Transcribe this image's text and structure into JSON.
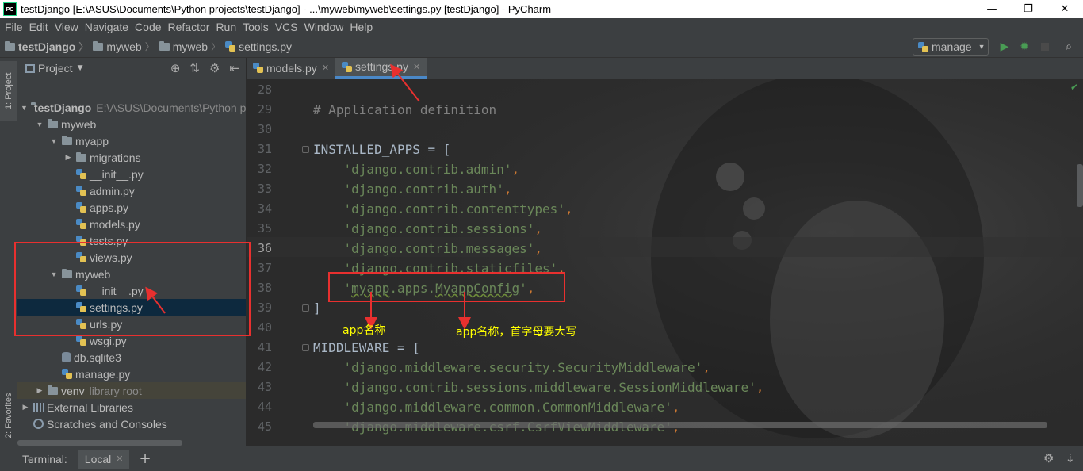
{
  "window": {
    "title": "testDjango [E:\\ASUS\\Documents\\Python projects\\testDjango] - ...\\myweb\\myweb\\settings.py [testDjango] - PyCharm",
    "logo_text": "PC",
    "minimize": "—",
    "maximize": "❐",
    "close": "✕"
  },
  "menu": [
    "File",
    "Edit",
    "View",
    "Navigate",
    "Code",
    "Refactor",
    "Run",
    "Tools",
    "VCS",
    "Window",
    "Help"
  ],
  "breadcrumb": [
    "testDjango",
    "myweb",
    "myweb",
    "settings.py"
  ],
  "run_config": {
    "label": "manage",
    "icons": [
      "run-icon",
      "debug-icon",
      "stop-icon",
      "search-icon"
    ]
  },
  "left_strip": {
    "project_tab": "1: Project",
    "favorites_tab": "2: Favorites"
  },
  "project_panel": {
    "title": "Project",
    "tree": [
      {
        "name": "testDjango",
        "extra": "E:\\ASUS\\Documents\\Python pr",
        "type": "folder",
        "depth": 0,
        "open": true,
        "bold": true
      },
      {
        "name": "myweb",
        "type": "folder",
        "depth": 1,
        "open": true
      },
      {
        "name": "myapp",
        "type": "folder",
        "depth": 2,
        "open": true
      },
      {
        "name": "migrations",
        "type": "folder",
        "depth": 3,
        "open": false
      },
      {
        "name": "__init__.py",
        "type": "py",
        "depth": 3
      },
      {
        "name": "admin.py",
        "type": "py",
        "depth": 3
      },
      {
        "name": "apps.py",
        "type": "py",
        "depth": 3
      },
      {
        "name": "models.py",
        "type": "py",
        "depth": 3
      },
      {
        "name": "tests.py",
        "type": "py",
        "depth": 3
      },
      {
        "name": "views.py",
        "type": "py",
        "depth": 3
      },
      {
        "name": "myweb",
        "type": "folder",
        "depth": 2,
        "open": true
      },
      {
        "name": "__init__.py",
        "type": "py",
        "depth": 3
      },
      {
        "name": "settings.py",
        "type": "py",
        "depth": 3,
        "selected": true
      },
      {
        "name": "urls.py",
        "type": "py",
        "depth": 3
      },
      {
        "name": "wsgi.py",
        "type": "py",
        "depth": 3
      },
      {
        "name": "db.sqlite3",
        "type": "db",
        "depth": 2
      },
      {
        "name": "manage.py",
        "type": "py",
        "depth": 2
      },
      {
        "name": "venv",
        "extra": "library root",
        "type": "folder",
        "depth": 1,
        "open": false,
        "lib": true
      },
      {
        "name": "External Libraries",
        "type": "lib",
        "depth": 0,
        "open": false
      },
      {
        "name": "Scratches and Consoles",
        "type": "scratch",
        "depth": 0
      }
    ]
  },
  "editor": {
    "tabs": [
      {
        "label": "models.py",
        "active": false
      },
      {
        "label": "settings.py",
        "active": true
      }
    ],
    "current_line": 36,
    "lines": [
      {
        "n": 28,
        "parts": []
      },
      {
        "n": 29,
        "parts": [
          {
            "t": "# Application definition",
            "c": "cm"
          }
        ]
      },
      {
        "n": 30,
        "parts": []
      },
      {
        "n": 31,
        "parts": [
          {
            "t": "INSTALLED_APPS = [",
            "c": ""
          }
        ]
      },
      {
        "n": 32,
        "parts": [
          {
            "t": "    ",
            "c": ""
          },
          {
            "t": "'django.contrib.admin'",
            "c": "st"
          },
          {
            "t": ",",
            "c": "pn"
          }
        ]
      },
      {
        "n": 33,
        "parts": [
          {
            "t": "    ",
            "c": ""
          },
          {
            "t": "'django.contrib.auth'",
            "c": "st"
          },
          {
            "t": ",",
            "c": "pn"
          }
        ]
      },
      {
        "n": 34,
        "parts": [
          {
            "t": "    ",
            "c": ""
          },
          {
            "t": "'django.contrib.contenttypes'",
            "c": "st"
          },
          {
            "t": ",",
            "c": "pn"
          }
        ]
      },
      {
        "n": 35,
        "parts": [
          {
            "t": "    ",
            "c": ""
          },
          {
            "t": "'django.contrib.sessions'",
            "c": "st"
          },
          {
            "t": ",",
            "c": "pn"
          }
        ]
      },
      {
        "n": 36,
        "parts": [
          {
            "t": "    ",
            "c": ""
          },
          {
            "t": "'django.contrib.messages'",
            "c": "st"
          },
          {
            "t": ",",
            "c": "pn"
          }
        ]
      },
      {
        "n": 37,
        "parts": [
          {
            "t": "    ",
            "c": ""
          },
          {
            "t": "'django.contrib.staticfiles'",
            "c": "st"
          },
          {
            "t": ",",
            "c": "pn"
          }
        ]
      },
      {
        "n": 38,
        "parts": [
          {
            "t": "    ",
            "c": ""
          },
          {
            "t": "'",
            "c": "st"
          },
          {
            "t": "myapp",
            "c": "st sq"
          },
          {
            "t": ".apps.",
            "c": "st"
          },
          {
            "t": "MyappConfig",
            "c": "st sq"
          },
          {
            "t": "'",
            "c": "st"
          },
          {
            "t": ",",
            "c": "pn"
          }
        ]
      },
      {
        "n": 39,
        "parts": [
          {
            "t": "]",
            "c": ""
          }
        ]
      },
      {
        "n": 40,
        "parts": []
      },
      {
        "n": 41,
        "parts": [
          {
            "t": "MIDDLEWARE = [",
            "c": ""
          }
        ]
      },
      {
        "n": 42,
        "parts": [
          {
            "t": "    ",
            "c": ""
          },
          {
            "t": "'django.middleware.security.SecurityMiddleware'",
            "c": "st"
          },
          {
            "t": ",",
            "c": "pn"
          }
        ]
      },
      {
        "n": 43,
        "parts": [
          {
            "t": "    ",
            "c": ""
          },
          {
            "t": "'django.contrib.sessions.middleware.SessionMiddleware'",
            "c": "st"
          },
          {
            "t": ",",
            "c": "pn"
          }
        ]
      },
      {
        "n": 44,
        "parts": [
          {
            "t": "    ",
            "c": ""
          },
          {
            "t": "'django.middleware.common.CommonMiddleware'",
            "c": "st"
          },
          {
            "t": ",",
            "c": "pn"
          }
        ]
      },
      {
        "n": 45,
        "parts": [
          {
            "t": "    ",
            "c": ""
          },
          {
            "t": "'django.middleware.csrf.CsrfViewMiddleware'",
            "c": "st"
          },
          {
            "t": ",",
            "c": "pn"
          }
        ]
      }
    ]
  },
  "annotations": {
    "app_name": "app名称",
    "app_class": "app名称，首字母要大写",
    "color": "#ffff00",
    "box_color": "#e8302f"
  },
  "terminal": {
    "label": "Terminal:",
    "tab": "Local",
    "add": "+"
  },
  "colors": {
    "string": "#6a8759",
    "comment": "#808080",
    "punct": "#cc7832",
    "text": "#a9b7c6",
    "selection": "#0d293e"
  }
}
